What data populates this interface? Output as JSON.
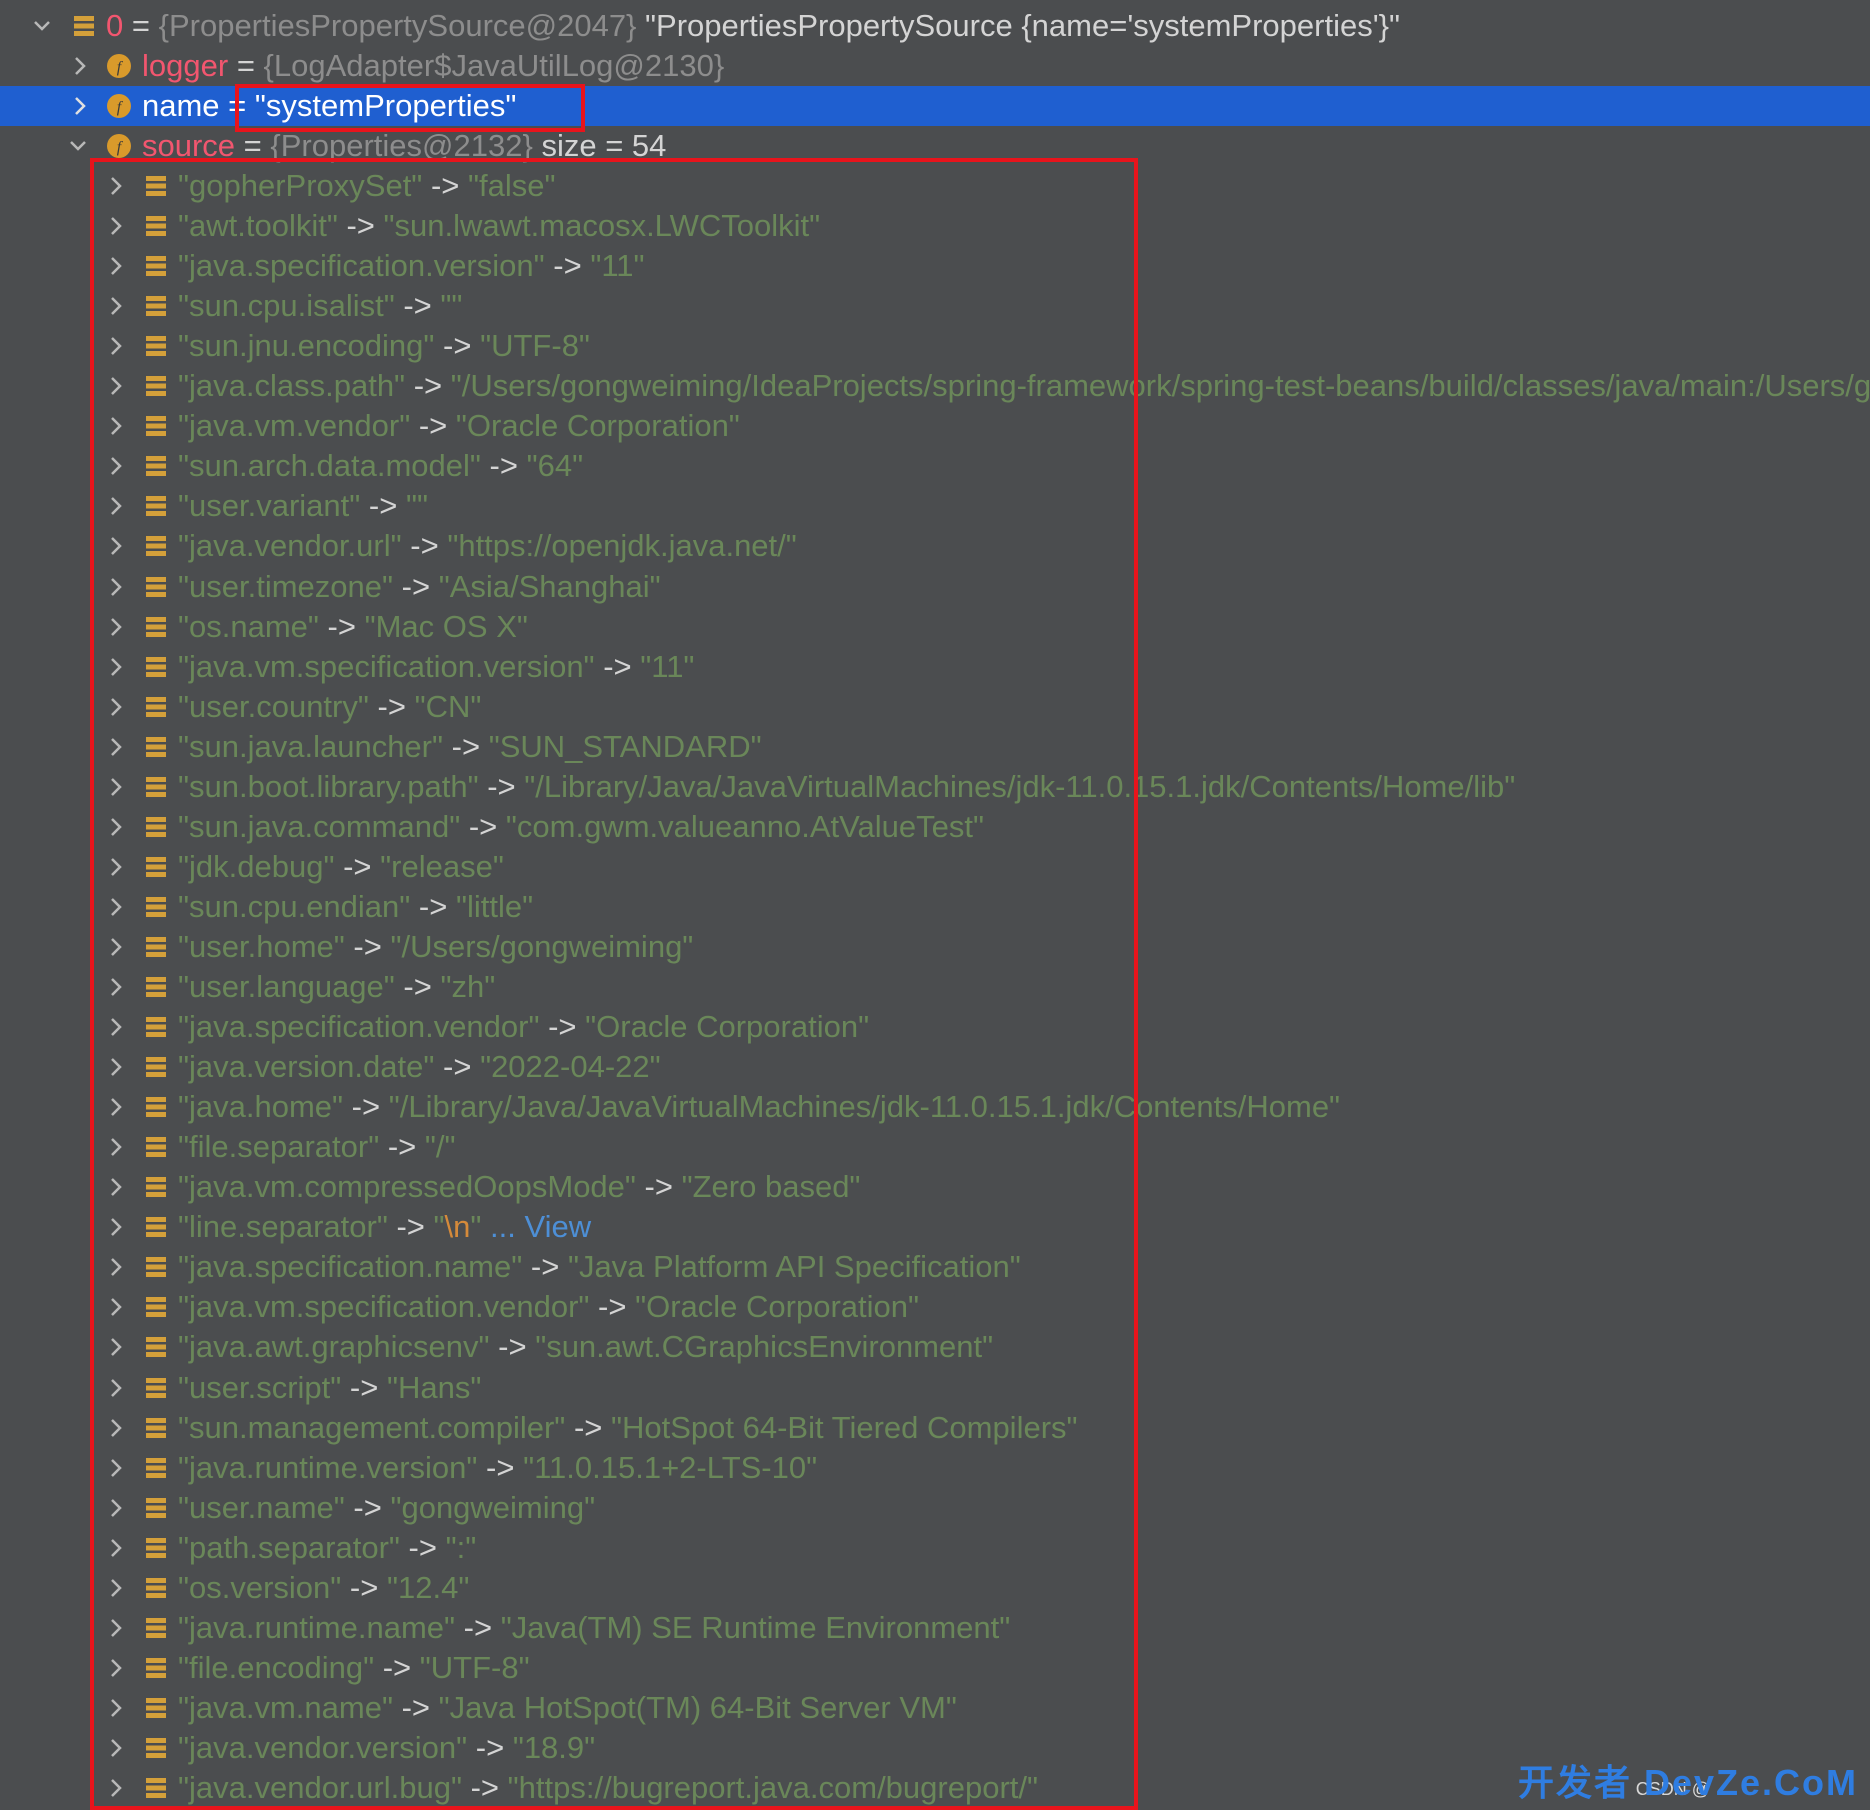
{
  "root": {
    "index": "0",
    "ref": "{PropertiesPropertySource@2047}",
    "value": "\"PropertiesPropertySource {name='systemProperties'}\""
  },
  "fields": {
    "logger": {
      "name": "logger",
      "ref": "{LogAdapter$JavaUtilLog@2130}"
    },
    "name": {
      "name": "name",
      "value": "\"systemProperties\""
    },
    "source": {
      "name": "source",
      "ref": "{Properties@2132}",
      "size": "size = 54"
    }
  },
  "assign": "=",
  "arrow": "->",
  "entries": [
    {
      "key": "\"gopherProxySet\"",
      "value": "\"false\""
    },
    {
      "key": "\"awt.toolkit\"",
      "value": "\"sun.lwawt.macosx.LWCToolkit\""
    },
    {
      "key": "\"java.specification.version\"",
      "value": "\"11\""
    },
    {
      "key": "\"sun.cpu.isalist\"",
      "value": "\"\""
    },
    {
      "key": "\"sun.jnu.encoding\"",
      "value": "\"UTF-8\""
    },
    {
      "key": "\"java.class.path\"",
      "value": "\"/Users/gongweiming/IdeaProjects/spring-framework/spring-test-beans/build/classes/java/main:/Users/g"
    },
    {
      "key": "\"java.vm.vendor\"",
      "value": "\"Oracle Corporation\""
    },
    {
      "key": "\"sun.arch.data.model\"",
      "value": "\"64\""
    },
    {
      "key": "\"user.variant\"",
      "value": "\"\""
    },
    {
      "key": "\"java.vendor.url\"",
      "value": "\"https://openjdk.java.net/\""
    },
    {
      "key": "\"user.timezone\"",
      "value": "\"Asia/Shanghai\""
    },
    {
      "key": "\"os.name\"",
      "value": "\"Mac OS X\""
    },
    {
      "key": "\"java.vm.specification.version\"",
      "value": "\"11\""
    },
    {
      "key": "\"user.country\"",
      "value": "\"CN\""
    },
    {
      "key": "\"sun.java.launcher\"",
      "value": "\"SUN_STANDARD\""
    },
    {
      "key": "\"sun.boot.library.path\"",
      "value": "\"/Library/Java/JavaVirtualMachines/jdk-11.0.15.1.jdk/Contents/Home/lib\""
    },
    {
      "key": "\"sun.java.command\"",
      "value": "\"com.gwm.valueanno.AtValueTest\""
    },
    {
      "key": "\"jdk.debug\"",
      "value": "\"release\""
    },
    {
      "key": "\"sun.cpu.endian\"",
      "value": "\"little\""
    },
    {
      "key": "\"user.home\"",
      "value": "\"/Users/gongweiming\""
    },
    {
      "key": "\"user.language\"",
      "value": "\"zh\""
    },
    {
      "key": "\"java.specification.vendor\"",
      "value": "\"Oracle Corporation\""
    },
    {
      "key": "\"java.version.date\"",
      "value": "\"2022-04-22\""
    },
    {
      "key": "\"java.home\"",
      "value": "\"/Library/Java/JavaVirtualMachines/jdk-11.0.15.1.jdk/Contents/Home\""
    },
    {
      "key": "\"file.separator\"",
      "value": "\"/\""
    },
    {
      "key": "\"java.vm.compressedOopsMode\"",
      "value": "\"Zero based\""
    },
    {
      "key": "\"line.separator\"",
      "value_pre": "\"",
      "value_esc": "\\n",
      "value_post": "\"",
      "view": "... View"
    },
    {
      "key": "\"java.specification.name\"",
      "value": "\"Java Platform API Specification\""
    },
    {
      "key": "\"java.vm.specification.vendor\"",
      "value": "\"Oracle Corporation\""
    },
    {
      "key": "\"java.awt.graphicsenv\"",
      "value": "\"sun.awt.CGraphicsEnvironment\""
    },
    {
      "key": "\"user.script\"",
      "value": "\"Hans\""
    },
    {
      "key": "\"sun.management.compiler\"",
      "value": "\"HotSpot 64-Bit Tiered Compilers\""
    },
    {
      "key": "\"java.runtime.version\"",
      "value": "\"11.0.15.1+2-LTS-10\""
    },
    {
      "key": "\"user.name\"",
      "value": "\"gongweiming\""
    },
    {
      "key": "\"path.separator\"",
      "value": "\":\""
    },
    {
      "key": "\"os.version\"",
      "value": "\"12.4\""
    },
    {
      "key": "\"java.runtime.name\"",
      "value": "\"Java(TM) SE Runtime Environment\""
    },
    {
      "key": "\"file.encoding\"",
      "value": "\"UTF-8\""
    },
    {
      "key": "\"java.vm.name\"",
      "value": "\"Java HotSpot(TM) 64-Bit Server VM\""
    },
    {
      "key": "\"java.vendor.version\"",
      "value": "\"18.9\""
    },
    {
      "key": "\"java.vendor.url.bug\"",
      "value": "\"https://bugreport.java.com/bugreport/\""
    }
  ],
  "watermark": {
    "small": "CSDN @",
    "big": "开发者 DevZe.CoM"
  },
  "colors": {
    "background": "#4b4d4f",
    "selection": "#1f5fd0",
    "string": "#6a8759",
    "field": "#f2566f",
    "highlight_box": "#e8141c",
    "icon_entry": "#d4a03a",
    "icon_field": "#d99a2b"
  },
  "icons": {
    "expand": "chevron-right-icon",
    "collapse": "chevron-down-icon",
    "entry": "map-entry-icon",
    "field": "field-f-icon"
  }
}
